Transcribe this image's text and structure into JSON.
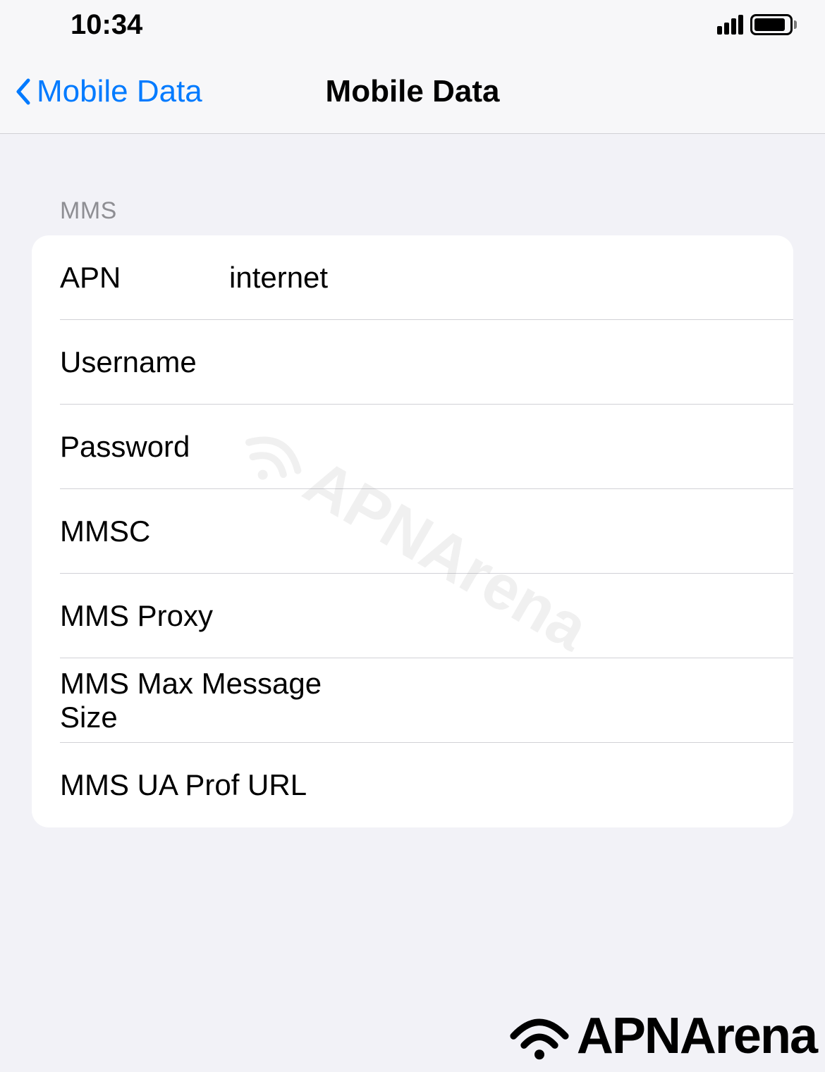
{
  "status_bar": {
    "time": "10:34"
  },
  "nav": {
    "back_label": "Mobile Data",
    "title": "Mobile Data"
  },
  "section": {
    "header": "MMS",
    "rows": [
      {
        "label": "APN",
        "value": "internet"
      },
      {
        "label": "Username",
        "value": ""
      },
      {
        "label": "Password",
        "value": ""
      },
      {
        "label": "MMSC",
        "value": ""
      },
      {
        "label": "MMS Proxy",
        "value": ""
      },
      {
        "label": "MMS Max Message Size",
        "value": ""
      },
      {
        "label": "MMS UA Prof URL",
        "value": ""
      }
    ]
  },
  "watermark": {
    "text": "APNArena"
  },
  "logo": {
    "text": "APNArena"
  }
}
